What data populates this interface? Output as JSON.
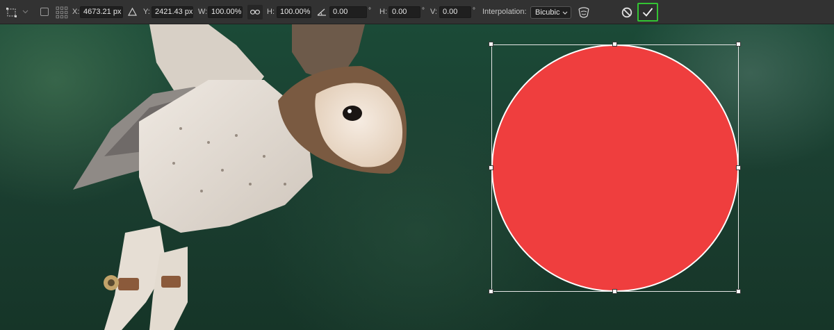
{
  "toolbar": {
    "x_label": "X:",
    "x_value": "4673.21 px",
    "y_label": "Y:",
    "y_value": "2421.43 px",
    "w_label": "W:",
    "w_value": "100.00%",
    "h_label": "H:",
    "h_value": "100.00%",
    "angle_value": "0.00",
    "angle_unit": "°",
    "hskew_label": "H:",
    "hskew_value": "0.00",
    "hskew_unit": "°",
    "vskew_label": "V:",
    "vskew_value": "0.00",
    "vskew_unit": "°",
    "interpolation_label": "Interpolation:",
    "interpolation_value": "Bicubic",
    "icons": [
      "transform-tool-icon",
      "chevron-down-icon",
      "reference-point-checkbox",
      "reference-point-grid-icon",
      "delta-icon",
      "link-icon",
      "rotate-angle-icon",
      "warp-icon",
      "cancel-icon",
      "checkmark-icon"
    ]
  },
  "colors": {
    "toolbar_bg": "#323232",
    "field_bg": "#1f1f1f",
    "shape_fill": "#ef3e3e",
    "commit_highlight": "#33c433",
    "background_green": "#1b4a37"
  }
}
